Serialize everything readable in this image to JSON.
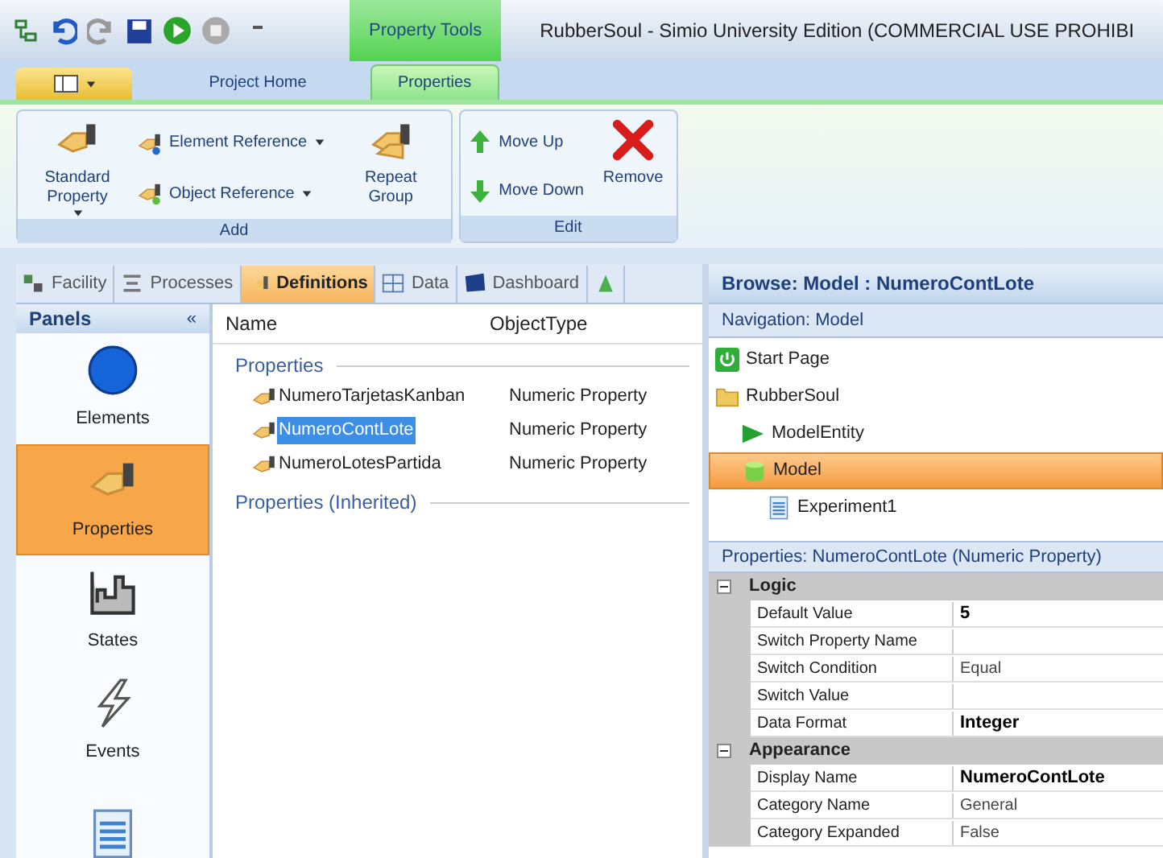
{
  "window": {
    "title": "RubberSoul - Simio University Edition (COMMERCIAL USE PROHIBI",
    "context_tab": "Property Tools"
  },
  "ribbon_tabs": [
    {
      "label": "Project Home",
      "selected": false
    },
    {
      "label": "Properties",
      "selected": true
    }
  ],
  "ribbon_groups": [
    {
      "label": "Add",
      "buttons": [
        {
          "kind": "large",
          "label": "Standard Property",
          "dropdown": true
        },
        {
          "kind": "stack",
          "items": [
            {
              "label": "Element Reference",
              "dropdown": true
            },
            {
              "label": "Object Reference",
              "dropdown": true
            }
          ]
        },
        {
          "kind": "large",
          "label": "Repeat Group",
          "dropdown": false
        }
      ]
    },
    {
      "label": "Edit",
      "buttons": [
        {
          "kind": "stack",
          "items": [
            {
              "label": "Move Up",
              "dropdown": false
            },
            {
              "label": "Move Down",
              "dropdown": false
            }
          ]
        },
        {
          "kind": "large",
          "label": "Remove",
          "dropdown": false
        }
      ]
    }
  ],
  "view_tabs": [
    {
      "label": "Facility",
      "selected": false
    },
    {
      "label": "Processes",
      "selected": false
    },
    {
      "label": "Definitions",
      "selected": true
    },
    {
      "label": "Data",
      "selected": false
    },
    {
      "label": "Dashboard",
      "selected": false
    },
    {
      "selected": false
    }
  ],
  "panels": {
    "title": "Panels",
    "collapse": "«",
    "items": [
      {
        "label": "Elements",
        "selected": false
      },
      {
        "label": "Properties",
        "selected": true
      },
      {
        "label": "States",
        "selected": false
      },
      {
        "label": "Events",
        "selected": false
      },
      {
        "selected": false
      }
    ]
  },
  "table": {
    "columns": [
      "Name",
      "ObjectType"
    ],
    "groups": [
      {
        "label": "Properties",
        "rows": [
          {
            "name": "NumeroTarjetasKanban",
            "type": "Numeric Property",
            "selected": false
          },
          {
            "name": "NumeroContLote",
            "type": "Numeric Property",
            "selected": true
          },
          {
            "name": "NumeroLotesPartida",
            "type": "Numeric Property",
            "selected": false
          }
        ]
      },
      {
        "label": "Properties (Inherited)"
      }
    ]
  },
  "browse": {
    "title": "Browse: Model : NumeroContLote",
    "navigation": "Navigation: Model",
    "tree": [
      {
        "label": "Start Page",
        "selected": false
      },
      {
        "label": "RubberSoul",
        "selected": false,
        "children": [
          {
            "label": "ModelEntity",
            "selected": false
          },
          {
            "label": "Model",
            "selected": true,
            "children": [
              {
                "label": "Experiment1",
                "selected": false
              }
            ]
          }
        ]
      }
    ]
  },
  "property_grid": {
    "title": "Properties: NumeroContLote (Numeric Property)",
    "categories": [
      {
        "label": "Logic",
        "expanded": true,
        "rows": [
          {
            "name": "Default Value",
            "value": "5",
            "bold": true
          },
          {
            "name": "Switch Property Name"
          },
          {
            "name": "Switch Condition",
            "value": "Equal",
            "bold": false
          },
          {
            "name": "Switch Value"
          },
          {
            "name": "Data Format",
            "value": "Integer",
            "bold": true
          }
        ]
      },
      {
        "label": "Appearance",
        "expanded": true,
        "rows": [
          {
            "name": "Display Name",
            "value": "NumeroContLote",
            "bold": true
          },
          {
            "name": "Category Name",
            "value": "General",
            "bold": false
          },
          {
            "name": "Category Expanded",
            "value": "False",
            "bold": false
          }
        ]
      }
    ]
  }
}
